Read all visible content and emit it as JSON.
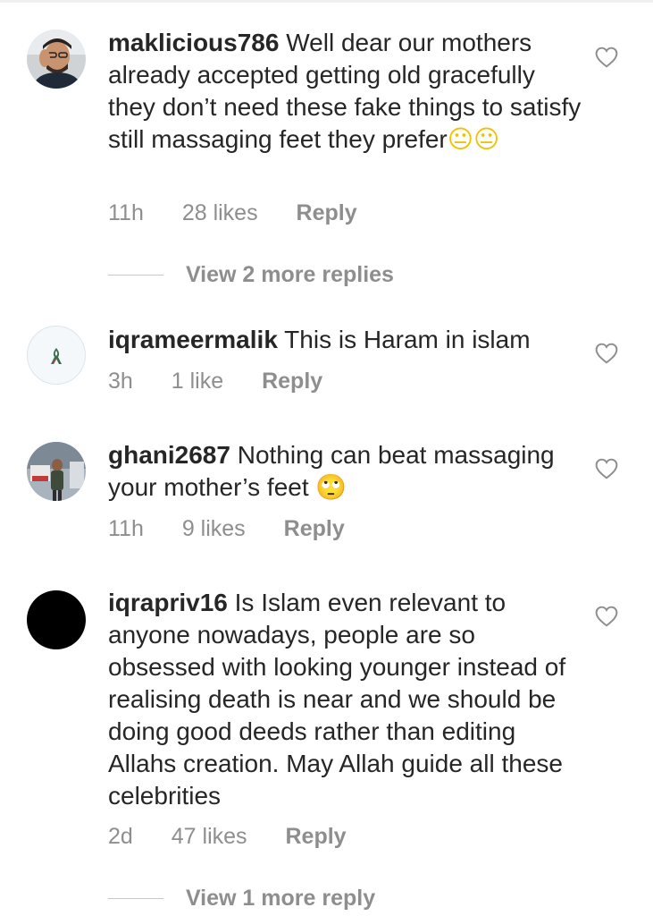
{
  "comments": [
    {
      "username": "maklicious786",
      "text": "Well dear our mothers already accepted getting old gracefully they don’t need these fake things to satisfy still massaging feet they prefer",
      "emoji": "😐😐",
      "time": "11h",
      "likes": "28 likes",
      "reply": "Reply",
      "view_more": "View 2 more replies"
    },
    {
      "username": "iqrameermalik",
      "text": "This is Haram in islam",
      "emoji": "",
      "time": "3h",
      "likes": "1 like",
      "reply": "Reply"
    },
    {
      "username": "ghani2687",
      "text": "Nothing can beat massaging your mother’s feet",
      "emoji": "🙄",
      "time": "11h",
      "likes": "9 likes",
      "reply": "Reply"
    },
    {
      "username": "iqrapriv16",
      "text": "Is Islam even relevant to anyone nowadays, people are so obsessed with looking younger instead of realising death is near and we should be doing good deeds rather than editing Allahs creation. May Allah guide all these celebrities",
      "emoji": "",
      "time": "2d",
      "likes": "47 likes",
      "reply": "Reply",
      "view_more": "View 1 more reply"
    }
  ],
  "icons": {
    "like": "heart-outline-icon",
    "ribbon": "ribbon-icon"
  },
  "colors": {
    "text": "#262626",
    "meta": "#8e8e8e",
    "avatar_black": "#000000"
  }
}
